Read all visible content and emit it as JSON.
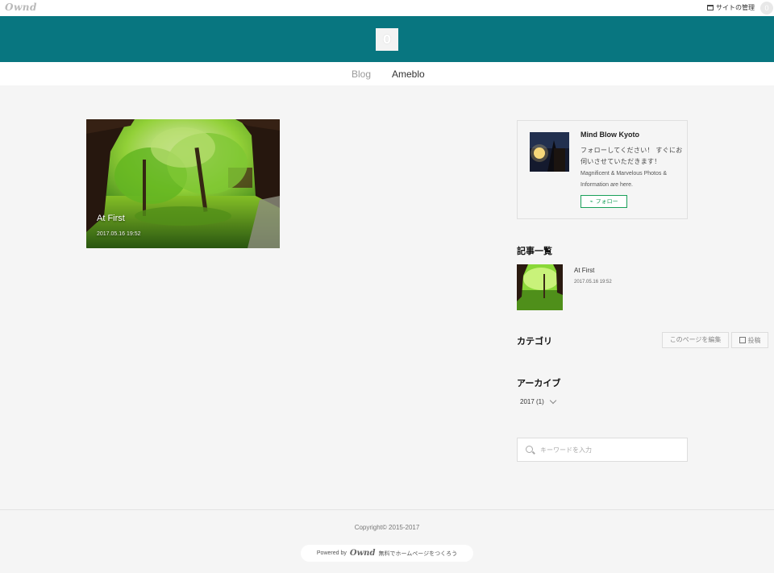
{
  "adminbar": {
    "logo": "Ownd",
    "manage_label": "サイトの管理",
    "avatar_letter": "0"
  },
  "header": {
    "site_icon_letter": "0",
    "brand_color": "#087680"
  },
  "nav": {
    "items": [
      {
        "label": "Blog"
      },
      {
        "label": "Ameblo"
      }
    ]
  },
  "main": {
    "posts": [
      {
        "title": "At First",
        "date": "2017.05.16 19:52"
      }
    ]
  },
  "profile": {
    "name": "Mind Blow Kyoto",
    "desc_jp": "フォローしてください！ すぐにお伺いさせていただきます！",
    "desc_en": "Magnificent & Marvelous Photos & Information are here.",
    "follow_label": "フォロー",
    "follow_color": "#1aa05a"
  },
  "sidebar": {
    "articles_heading": "記事一覧",
    "articles": [
      {
        "title": "At First",
        "date": "2017.05.16 19:52"
      }
    ],
    "category_heading": "カテゴリ",
    "edit_page_label": "このページを編集",
    "post_label": "投稿",
    "archive_heading": "アーカイブ",
    "archive_items": [
      {
        "label": "2017 (1)"
      }
    ],
    "search_placeholder": "キーワードを入力"
  },
  "footer": {
    "copyright": "Copyright© 2015-2017",
    "powered_by": "Powered by",
    "powered_logo": "Ownd",
    "powered_tagline": "無料でホームページをつくろう"
  }
}
